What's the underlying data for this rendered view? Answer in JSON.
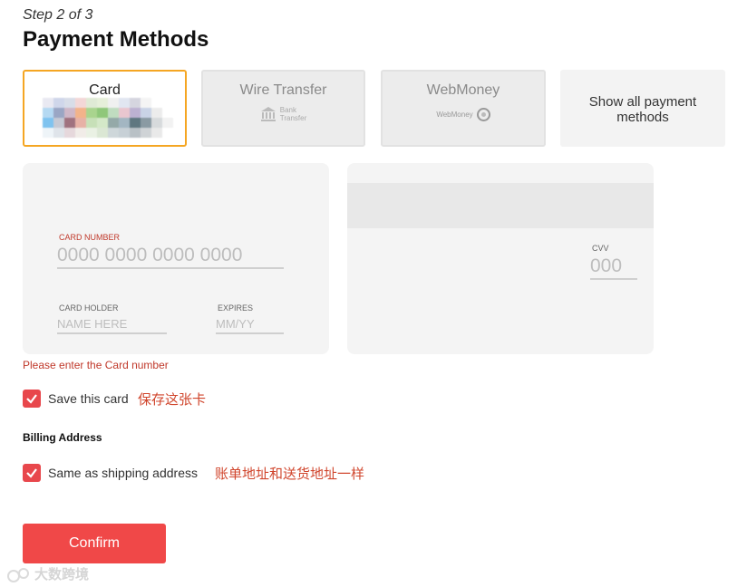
{
  "header": {
    "step": "Step 2 of 3",
    "title": "Payment Methods"
  },
  "methods": [
    {
      "label": "Card",
      "selected": true
    },
    {
      "label": "Wire Transfer",
      "sublabel_line1": "Bank",
      "sublabel_line2": "Transfer"
    },
    {
      "label": "WebMoney",
      "sublabel": "WebMoney"
    },
    {
      "label": "Show all payment methods"
    }
  ],
  "card_form": {
    "number_label": "CARD NUMBER",
    "number_placeholder": "0000 0000 0000 0000",
    "holder_label": "CARD HOLDER",
    "holder_placeholder": "NAME HERE",
    "expires_label": "EXPIRES",
    "expires_placeholder": "MM/YY",
    "cvv_label": "CVV",
    "cvv_placeholder": "000"
  },
  "error": "Please enter the Card number",
  "save_card": {
    "label": "Save this card",
    "annotation": "保存这张卡",
    "checked": true
  },
  "billing": {
    "heading": "Billing Address",
    "same_label": "Same as shipping address",
    "annotation": "账单地址和送货地址一样",
    "checked": true
  },
  "confirm_label": "Confirm",
  "watermark": "大数跨境",
  "colors": {
    "accent": "#f04848",
    "selected_border": "#f5a623",
    "error": "#c0392b",
    "annotation": "#d0452c"
  }
}
